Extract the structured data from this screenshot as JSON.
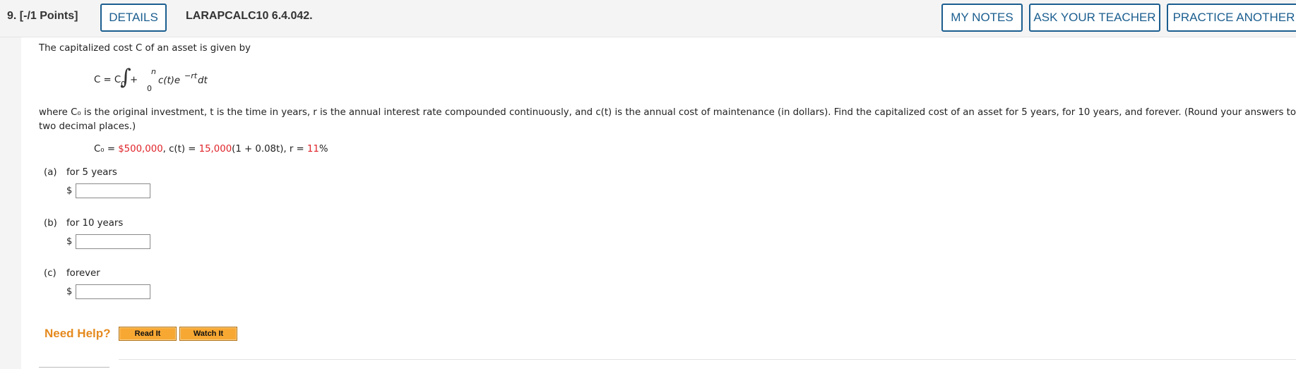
{
  "header": {
    "question_number": "9. [-/1 Points]",
    "details_label": "DETAILS",
    "question_id": "LARAPCALC10 6.4.042.",
    "my_notes_label": "MY NOTES",
    "ask_teacher_label": "ASK YOUR TEACHER",
    "practice_label": "PRACTICE ANOTHER"
  },
  "problem": {
    "intro": "The capitalized cost C of an asset is given by",
    "formula_lhs": "C = C",
    "formula_sub0": "0",
    "formula_plus": "+",
    "upper_limit": "n",
    "lower_limit": "0",
    "integrand": "c(t)e",
    "exponent": "−rt",
    "dt": "dt",
    "description_line1": "where C₀ is the original investment, t is the time in years, r is the annual interest rate compounded continuously, and c(t) is the annual cost of maintenance (in dollars). Find the capitalized cost of an asset for 5 years, for 10 years, and forever. (Round your answers to",
    "description_line2": "two decimal places.)",
    "given_prefix": "C₀ = ",
    "given_c0": "$500,000",
    "given_mid": ", c(t) = ",
    "given_c_coef": "15,000",
    "given_c_rest": "(1 + 0.08t), r = ",
    "given_r": "11",
    "given_r_unit": "%"
  },
  "parts": [
    {
      "label": "(a)",
      "text": "for 5 years",
      "currency": "$",
      "value": ""
    },
    {
      "label": "(b)",
      "text": "for 10 years",
      "currency": "$",
      "value": ""
    },
    {
      "label": "(c)",
      "text": "forever",
      "currency": "$",
      "value": ""
    }
  ],
  "help": {
    "title": "Need Help?",
    "read_label": "Read It",
    "watch_label": "Watch It"
  },
  "colors": {
    "accent": "#1b5e8f",
    "given_value": "#e0242a",
    "help_title": "#e58a1f",
    "help_button": "#f7a833"
  }
}
